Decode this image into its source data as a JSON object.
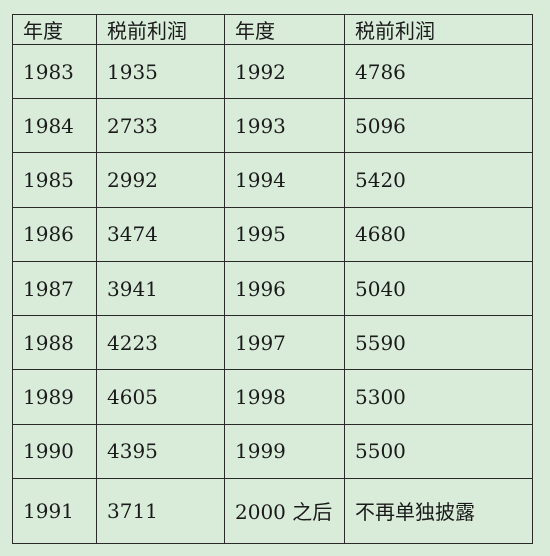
{
  "table": {
    "headers": [
      "年度",
      "税前利润",
      "年度",
      "税前利润"
    ],
    "rows": [
      [
        "1983",
        "1935",
        "1992",
        "4786"
      ],
      [
        "1984",
        "2733",
        "1993",
        "5096"
      ],
      [
        "1985",
        "2992",
        "1994",
        "5420"
      ],
      [
        "1986",
        "3474",
        "1995",
        "4680"
      ],
      [
        "1987",
        "3941",
        "1996",
        "5040"
      ],
      [
        "1988",
        "4223",
        "1997",
        "5590"
      ],
      [
        "1989",
        "4605",
        "1998",
        "5300"
      ],
      [
        "1990",
        "4395",
        "1999",
        "5500"
      ],
      [
        "1991",
        "3711",
        "2000 之后",
        "不再单独披露"
      ]
    ]
  }
}
